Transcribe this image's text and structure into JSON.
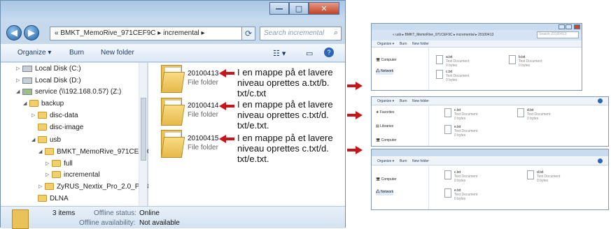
{
  "window": {
    "breadcrumb": "« BMKT_MemoRive_971CEF9C ▸ incremental ▸",
    "search_placeholder": "Search incremental",
    "toolbar": {
      "organize": "Organize ▾",
      "burn": "Burn",
      "new_folder": "New folder"
    }
  },
  "nav_tree": [
    {
      "label": "Local Disk (C:)",
      "kind": "drive"
    },
    {
      "label": "Local Disk (D:)",
      "kind": "drive"
    },
    {
      "label": "service (\\\\192.168.0.57) (Z:)",
      "kind": "network"
    },
    {
      "label": "backup",
      "kind": "folder"
    },
    {
      "label": "disc-data",
      "kind": "folder"
    },
    {
      "label": "disc-image",
      "kind": "folder"
    },
    {
      "label": "usb",
      "kind": "folder"
    },
    {
      "label": "BMKT_MemoRive_971CEF9C",
      "kind": "folder"
    },
    {
      "label": "full",
      "kind": "folder"
    },
    {
      "label": "incremental",
      "kind": "folder"
    },
    {
      "label": "ZyRUS_Nextix_Pro_2.0_P_68E",
      "kind": "folder"
    },
    {
      "label": "DLNA",
      "kind": "folder"
    }
  ],
  "folders": [
    {
      "name": "20100413",
      "type": "File folder"
    },
    {
      "name": "20100414",
      "type": "File folder"
    },
    {
      "name": "20100415",
      "type": "File folder"
    }
  ],
  "notes": [
    "I en mappe på et lavere niveau oprettes a.txt/b. txt/c.txt",
    "I en mappe på et lavere niveau oprettes c.txt/d. txt/e.txt.",
    "I en mappe på et lavere niveau oprettes c.txt/d. txt/e.txt."
  ],
  "status": {
    "count": "3 items",
    "offline_status_label": "Offline status:",
    "offline_status_value": "Online",
    "offline_avail_label": "Offline availability:",
    "offline_avail_value": "Not available"
  },
  "small_windows": [
    {
      "address": "« usb ▸ BMKT_MemoRive_971CEF9C ▸ incremental ▸ 20100413",
      "search": "Search 20100413",
      "nav": [
        "Computer",
        "Network"
      ],
      "files": [
        {
          "name": "a.txt",
          "type": "Text Document",
          "size": "0 bytes"
        },
        {
          "name": "b.txt",
          "type": "Text Document",
          "size": "0 bytes"
        },
        {
          "name": "c.txt",
          "type": "Text Document",
          "size": "0 bytes"
        }
      ]
    },
    {
      "nav": [
        "Favorites",
        "Libraries",
        "Computer"
      ],
      "files": [
        {
          "name": "c.txt",
          "type": "Text Document",
          "size": "0 bytes"
        },
        {
          "name": "d.txt",
          "type": "Text Document",
          "size": "0 bytes"
        },
        {
          "name": "e.txt",
          "type": "Text Document",
          "size": "0 bytes"
        }
      ]
    },
    {
      "nav": [
        "Computer",
        "Network"
      ],
      "files": [
        {
          "name": "c.txt",
          "type": "Text Document",
          "size": "0 bytes"
        },
        {
          "name": "d.txt",
          "type": "Text Document",
          "size": "0 bytes"
        },
        {
          "name": "e.txt",
          "type": "Text Document",
          "size": "0 bytes"
        }
      ]
    }
  ],
  "small_toolbar": {
    "organize": "Organize ▾",
    "burn": "Burn",
    "new_folder": "New folder"
  }
}
